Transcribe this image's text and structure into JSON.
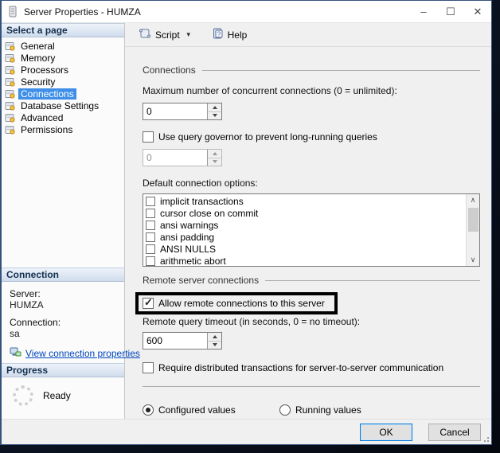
{
  "window": {
    "title": "Server Properties - HUMZA",
    "icons": {
      "minimize": "–",
      "maximize": "☐",
      "close": "✕"
    }
  },
  "toolbar": {
    "script_label": "Script",
    "help_label": "Help"
  },
  "sidebar": {
    "select_page_header": "Select a page",
    "pages": [
      {
        "label": "General",
        "selected": false
      },
      {
        "label": "Memory",
        "selected": false
      },
      {
        "label": "Processors",
        "selected": false
      },
      {
        "label": "Security",
        "selected": false
      },
      {
        "label": "Connections",
        "selected": true
      },
      {
        "label": "Database Settings",
        "selected": false
      },
      {
        "label": "Advanced",
        "selected": false
      },
      {
        "label": "Permissions",
        "selected": false
      }
    ],
    "connection_header": "Connection",
    "server_label": "Server:",
    "server_value": "HUMZA",
    "connection_label": "Connection:",
    "connection_value": "sa",
    "view_link": "View connection properties",
    "progress_header": "Progress",
    "progress_status": "Ready"
  },
  "main": {
    "connections_group": "Connections",
    "max_connections_label": "Maximum number of concurrent connections (0 = unlimited):",
    "max_connections_value": "0",
    "query_governor_label": "Use query governor to prevent long-running queries",
    "query_governor_checked": false,
    "query_governor_value": "0",
    "default_options_label": "Default connection options:",
    "connection_options": [
      {
        "label": "implicit transactions",
        "checked": false
      },
      {
        "label": "cursor close on commit",
        "checked": false
      },
      {
        "label": "ansi warnings",
        "checked": false
      },
      {
        "label": "ansi padding",
        "checked": false
      },
      {
        "label": "ANSI NULLS",
        "checked": false
      },
      {
        "label": "arithmetic abort",
        "checked": false
      }
    ],
    "remote_group": "Remote server connections",
    "allow_remote_label": "Allow remote connections to this server",
    "allow_remote_checked": true,
    "remote_timeout_label": "Remote query timeout (in seconds, 0 = no timeout):",
    "remote_timeout_value": "600",
    "distributed_label": "Require distributed transactions for server-to-server communication",
    "distributed_checked": false,
    "radio_configured_label": "Configured values",
    "radio_configured_selected": true,
    "radio_running_label": "Running values",
    "radio_running_selected": false
  },
  "footer": {
    "ok_label": "OK",
    "cancel_label": "Cancel"
  },
  "colors": {
    "selection": "#3f8fe8",
    "highlight_border": "#000000",
    "link": "#0046bd",
    "ok_focus": "#0078d7"
  }
}
